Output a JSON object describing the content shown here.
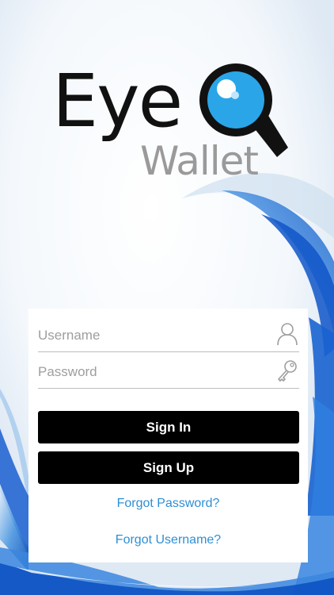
{
  "logo": {
    "eye_text": "Eye",
    "wallet_text": "Wallet",
    "q_icon": "magnifier-q-icon"
  },
  "form": {
    "username_placeholder": "Username",
    "username_value": "",
    "username_icon": "user-icon",
    "password_placeholder": "Password",
    "password_value": "",
    "password_icon": "key-icon",
    "sign_in_label": "Sign In",
    "sign_up_label": "Sign Up",
    "forgot_password_label": "Forgot Password?",
    "forgot_username_label": "Forgot Username?"
  },
  "colors": {
    "accent_blue": "#2e8fd4",
    "button_bg": "#000000",
    "logo_q_blue": "#2aa6e8",
    "wallet_gray": "#9a9a9a"
  }
}
